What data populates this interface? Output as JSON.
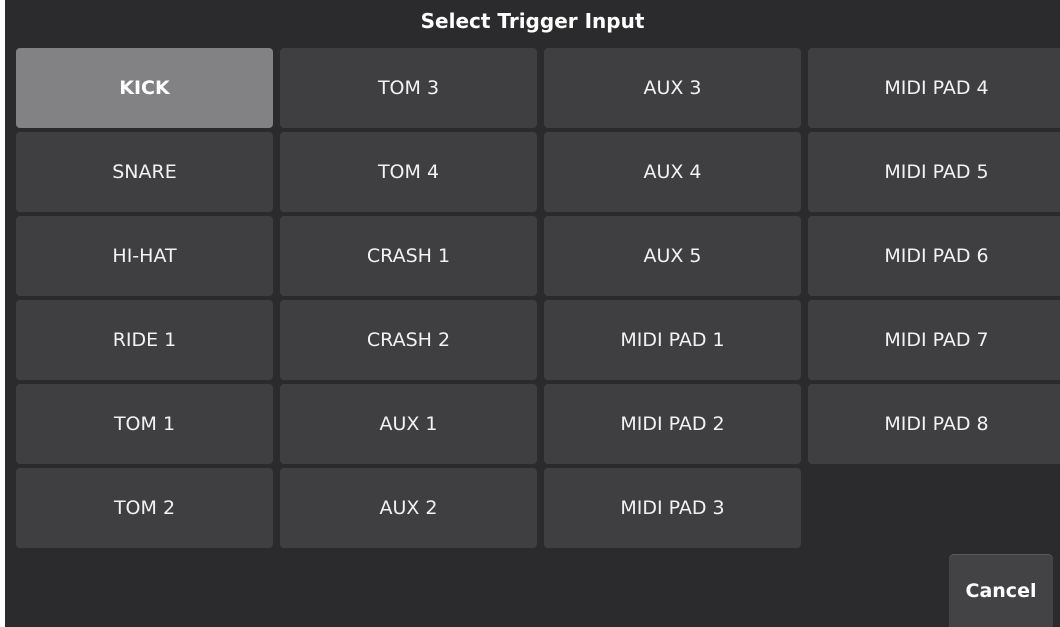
{
  "dialog": {
    "title": "Select Trigger Input",
    "selected": "KICK"
  },
  "inputs": [
    [
      "KICK",
      "TOM 3",
      "AUX 3",
      "MIDI PAD 4"
    ],
    [
      "SNARE",
      "TOM 4",
      "AUX 4",
      "MIDI PAD 5"
    ],
    [
      "HI-HAT",
      "CRASH 1",
      "AUX 5",
      "MIDI PAD 6"
    ],
    [
      "RIDE 1",
      "CRASH 2",
      "MIDI PAD 1",
      "MIDI PAD 7"
    ],
    [
      "TOM 1",
      "AUX 1",
      "MIDI PAD 2",
      "MIDI PAD 8"
    ],
    [
      "TOM 2",
      "AUX 2",
      "MIDI PAD 3",
      ""
    ]
  ],
  "actions": {
    "cancel_label": "Cancel"
  },
  "colors": {
    "background": "#2b2b2d",
    "pad": "#3f3f41",
    "pad_selected": "#828284",
    "text": "#ffffff"
  }
}
